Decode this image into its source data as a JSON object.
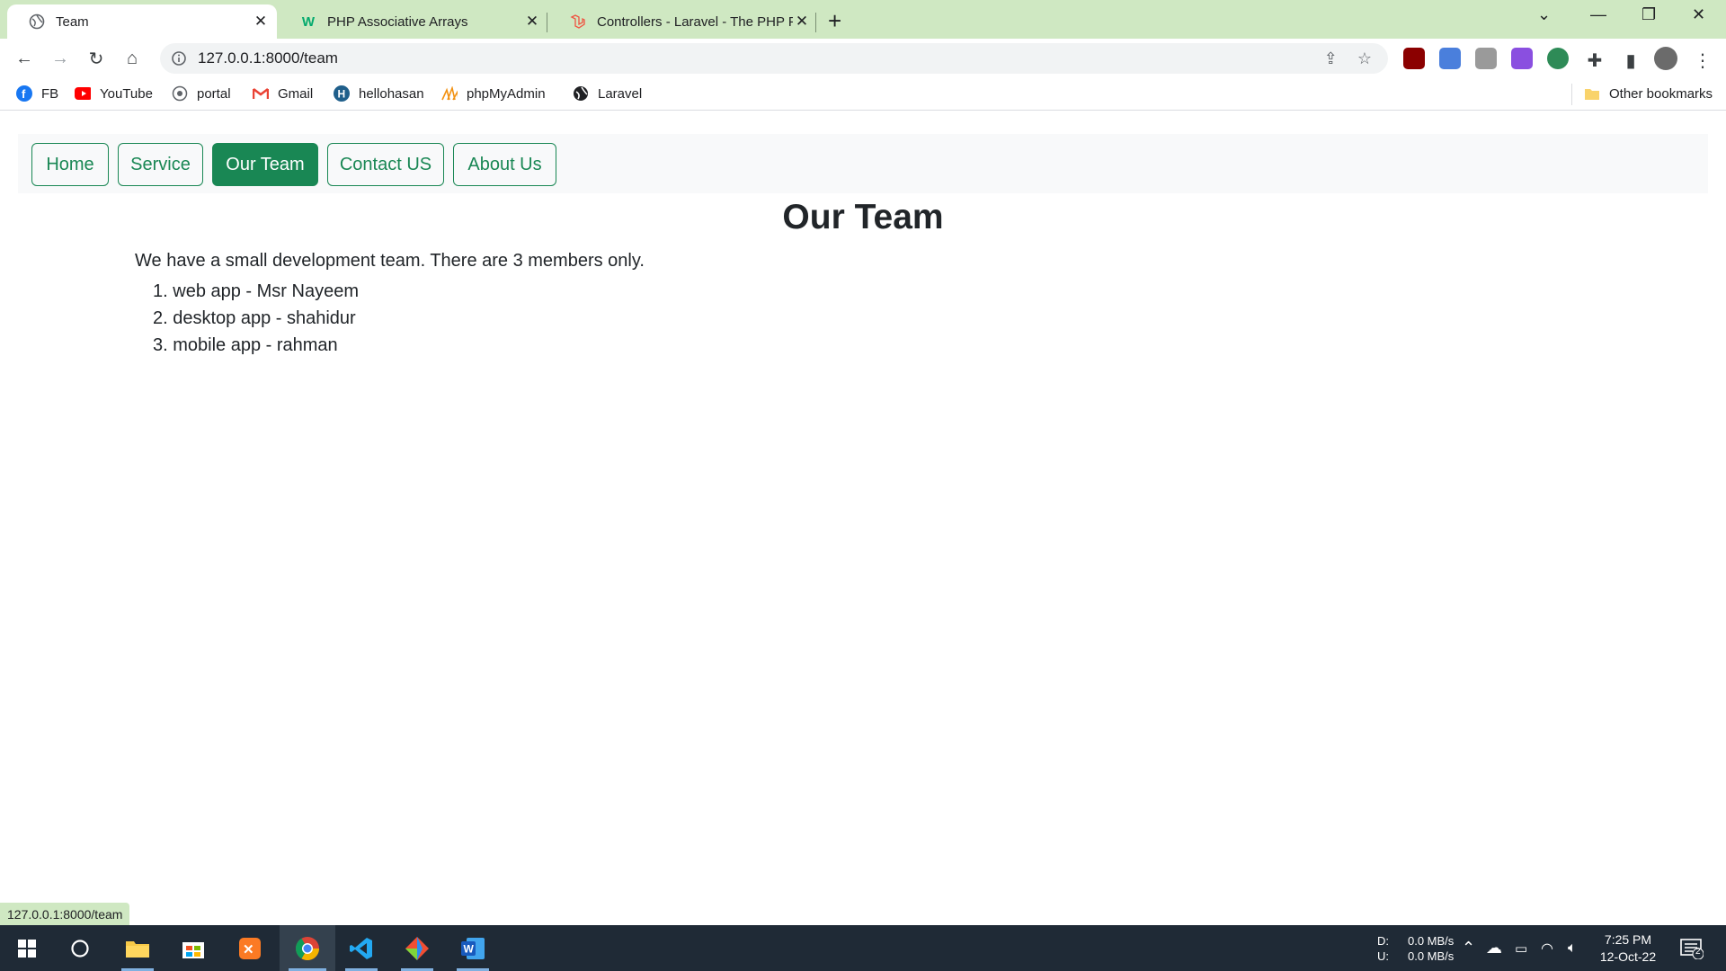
{
  "browser": {
    "tabs": [
      {
        "title": "Team",
        "active": true
      },
      {
        "title": "PHP Associative Arrays",
        "active": false
      },
      {
        "title": "Controllers - Laravel - The PHP Fr",
        "active": false
      }
    ],
    "url": "127.0.0.1:8000/team",
    "bookmarks": [
      "FB",
      "YouTube",
      "portal",
      "Gmail",
      "hellohasan",
      "phpMyAdmin",
      "Laravel"
    ],
    "other_bookmarks": "Other bookmarks",
    "status_url": "127.0.0.1:8000/team"
  },
  "nav": {
    "items": [
      {
        "label": "Home"
      },
      {
        "label": "Service"
      },
      {
        "label": "Our Team"
      },
      {
        "label": "Contact US"
      },
      {
        "label": "About Us"
      }
    ],
    "active": "Our Team"
  },
  "content": {
    "heading": "Our Team",
    "intro": "We have a small development team. There are 3 members only.",
    "members": [
      "web app - Msr Nayeem",
      "desktop app - shahidur",
      "mobile app - rahman"
    ]
  },
  "taskbar": {
    "net_d_label": "D:",
    "net_u_label": "U:",
    "net_d": "0.0 MB/s",
    "net_u": "0.0 MB/s",
    "time": "7:25 PM",
    "date": "12-Oct-22",
    "notifications": "2"
  },
  "colors": {
    "accent": "#198754",
    "tabstrip": "#cfe8c2",
    "taskbar": "#1f2a36"
  }
}
